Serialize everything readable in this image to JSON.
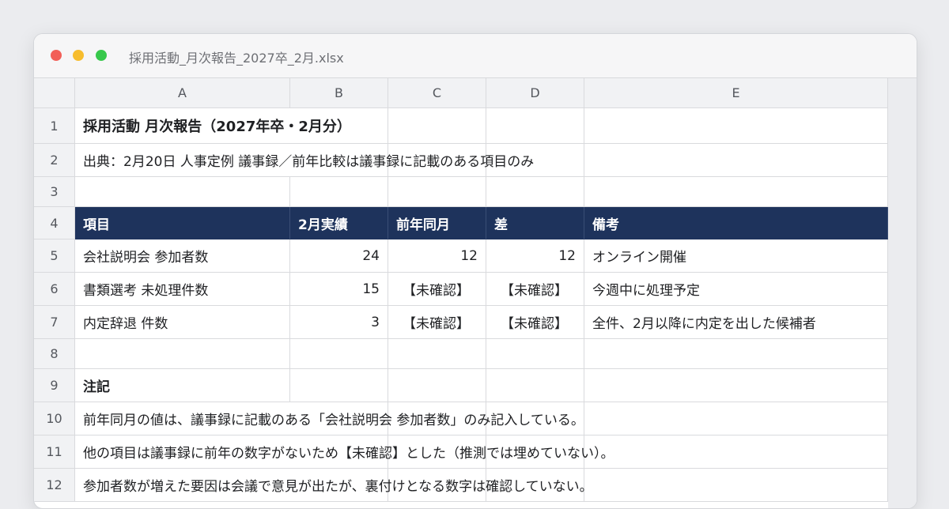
{
  "window": {
    "title": "採用活動_月次報告_2027卒_2月.xlsx"
  },
  "columns": [
    "A",
    "B",
    "C",
    "D",
    "E"
  ],
  "rows": [
    {
      "num": "1",
      "a": "採用活動 月次報告（2027年卒・2月分）",
      "b": "",
      "c": "",
      "d": "",
      "e": ""
    },
    {
      "num": "2",
      "a": "出典：2月20日 人事定例 議事録／前年比較は議事録に記載のある項目のみ",
      "b": "",
      "c": "",
      "d": "",
      "e": ""
    },
    {
      "num": "3",
      "a": "",
      "b": "",
      "c": "",
      "d": "",
      "e": ""
    },
    {
      "num": "4",
      "a": "項目",
      "b": "2月実績",
      "c": "前年同月",
      "d": "差",
      "e": "備考"
    },
    {
      "num": "5",
      "a": "会社説明会 参加者数",
      "b": "24",
      "c": "12",
      "d": "12",
      "e": "オンライン開催"
    },
    {
      "num": "6",
      "a": "書類選考 未処理件数",
      "b": "15",
      "c": "【未確認】",
      "d": "【未確認】",
      "e": "今週中に処理予定"
    },
    {
      "num": "7",
      "a": "内定辞退 件数",
      "b": "3",
      "c": "【未確認】",
      "d": "【未確認】",
      "e": "全件、2月以降に内定を出した候補者"
    },
    {
      "num": "8",
      "a": "",
      "b": "",
      "c": "",
      "d": "",
      "e": ""
    },
    {
      "num": "9",
      "a": "注記",
      "b": "",
      "c": "",
      "d": "",
      "e": ""
    },
    {
      "num": "10",
      "a": "前年同月の値は、議事録に記載のある「会社説明会 参加者数」のみ記入している。",
      "b": "",
      "c": "",
      "d": "",
      "e": ""
    },
    {
      "num": "11",
      "a": "他の項目は議事録に前年の数字がないため【未確認】とした（推測では埋めていない）。",
      "b": "",
      "c": "",
      "d": "",
      "e": ""
    },
    {
      "num": "12",
      "a": "参加者数が増えた要因は会議で意見が出たが、裏付けとなる数字は確認していない。",
      "b": "",
      "c": "",
      "d": "",
      "e": ""
    }
  ],
  "colors": {
    "header_fill": "#1e335c",
    "header_text": "#ffffff"
  }
}
